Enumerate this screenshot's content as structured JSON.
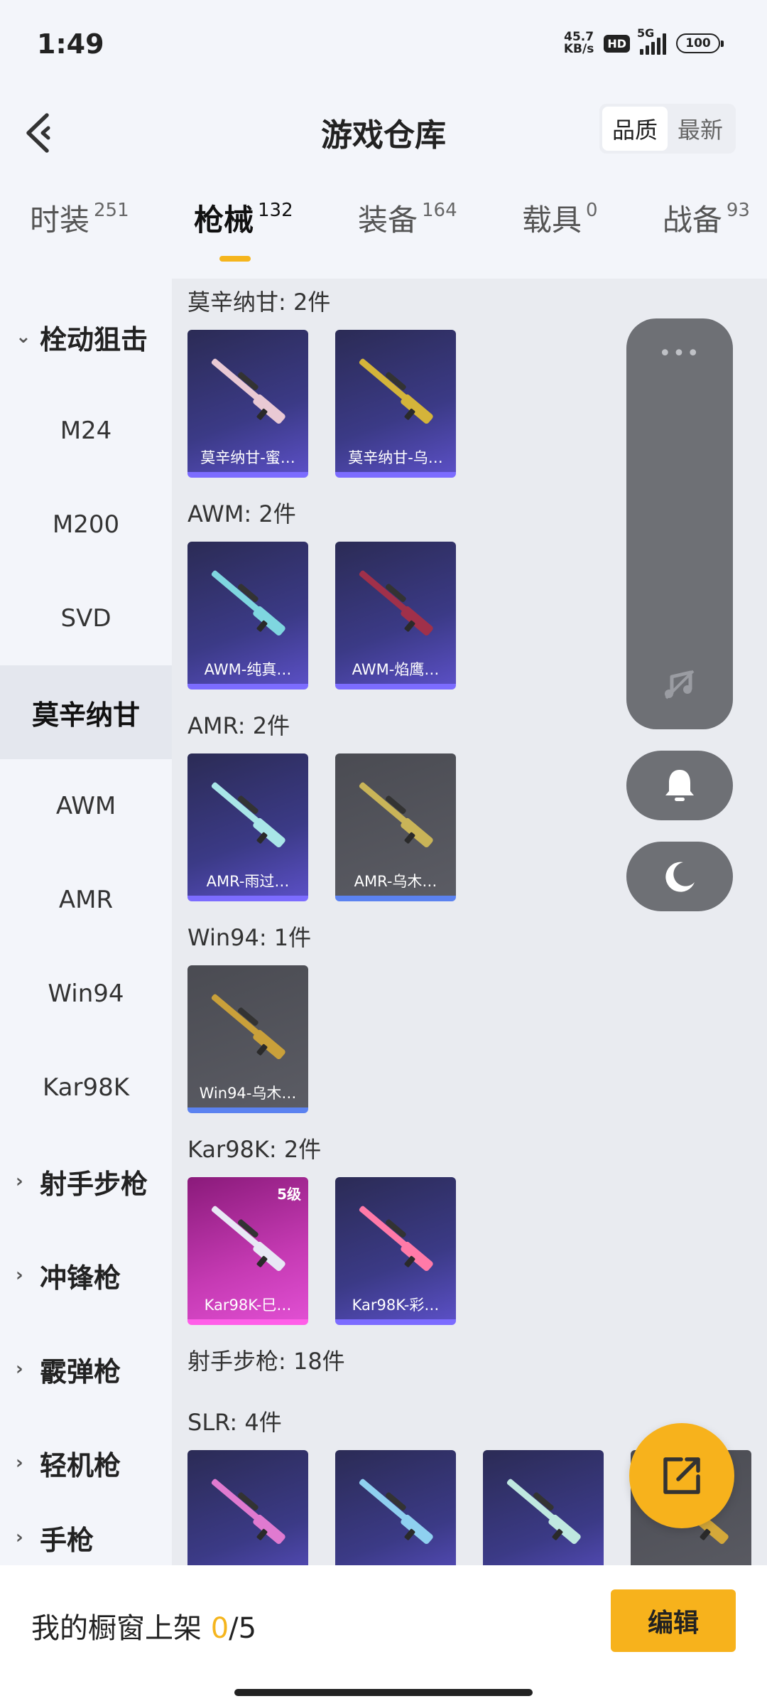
{
  "status": {
    "time": "1:49",
    "speed_value": "45.7",
    "speed_unit": "KB/s",
    "hd": "HD",
    "network": "5G",
    "battery": "100"
  },
  "header": {
    "title": "游戏仓库",
    "sort_options": [
      "品质",
      "最新"
    ],
    "sort_active": "品质"
  },
  "category_tabs": [
    {
      "label": "时装",
      "count": "251"
    },
    {
      "label": "枪械",
      "count": "132"
    },
    {
      "label": "装备",
      "count": "164"
    },
    {
      "label": "载具",
      "count": "0"
    },
    {
      "label": "战备",
      "count": "93"
    }
  ],
  "sidebar": {
    "items": [
      {
        "label": "栓动狙击",
        "type": "group",
        "expanded": true
      },
      {
        "label": "M24",
        "type": "sub"
      },
      {
        "label": "M200",
        "type": "sub"
      },
      {
        "label": "SVD",
        "type": "sub"
      },
      {
        "label": "莫辛纳甘",
        "type": "sub",
        "active": true
      },
      {
        "label": "AWM",
        "type": "sub"
      },
      {
        "label": "AMR",
        "type": "sub"
      },
      {
        "label": "Win94",
        "type": "sub"
      },
      {
        "label": "Kar98K",
        "type": "sub"
      },
      {
        "label": "射手步枪",
        "type": "group"
      },
      {
        "label": "冲锋枪",
        "type": "group"
      },
      {
        "label": "霰弹枪",
        "type": "group"
      },
      {
        "label": "轻机枪",
        "type": "group"
      },
      {
        "label": "手枪",
        "type": "group"
      }
    ]
  },
  "groups": [
    {
      "title": "莫辛纳甘: 2件",
      "items": [
        {
          "name": "莫辛纳甘-蜜…",
          "quality": "purple",
          "gun_color": "#e9c9d4"
        },
        {
          "name": "莫辛纳甘-乌…",
          "quality": "purple",
          "gun_color": "#d4b43a"
        }
      ]
    },
    {
      "title": "AWM: 2件",
      "items": [
        {
          "name": "AWM-纯真…",
          "quality": "purple",
          "gun_color": "#7fd6e0"
        },
        {
          "name": "AWM-焰鹰…",
          "quality": "purple",
          "gun_color": "#a0304a"
        }
      ]
    },
    {
      "title": "AMR: 2件",
      "items": [
        {
          "name": "AMR-雨过…",
          "quality": "purple",
          "gun_color": "#a9e6e8"
        },
        {
          "name": "AMR-乌木…",
          "quality": "gray",
          "gun_color": "#c9b458"
        }
      ]
    },
    {
      "title": "Win94: 1件",
      "items": [
        {
          "name": "Win94-乌木…",
          "quality": "gray",
          "gun_color": "#c9a03a"
        }
      ]
    },
    {
      "title": "Kar98K: 2件",
      "items": [
        {
          "name": "Kar98K-巳…",
          "quality": "pink",
          "gun_color": "#e8e8f5",
          "level": "5级"
        },
        {
          "name": "Kar98K-彩…",
          "quality": "purple",
          "gun_color": "#ff7aa8"
        }
      ]
    }
  ],
  "section_header": "射手步枪: 18件",
  "slr": {
    "title": "SLR: 4件",
    "items": [
      {
        "quality": "purple",
        "gun_color": "#e07ad0"
      },
      {
        "quality": "purple",
        "gun_color": "#8fd0f0"
      },
      {
        "quality": "purple",
        "gun_color": "#bfe8e0"
      },
      {
        "quality": "gray",
        "gun_color": "#d4a83a"
      }
    ]
  },
  "bottom": {
    "showcase_label": "我的橱窗上架",
    "showcase_current": "0",
    "showcase_total": "/5",
    "edit_label": "编辑"
  }
}
